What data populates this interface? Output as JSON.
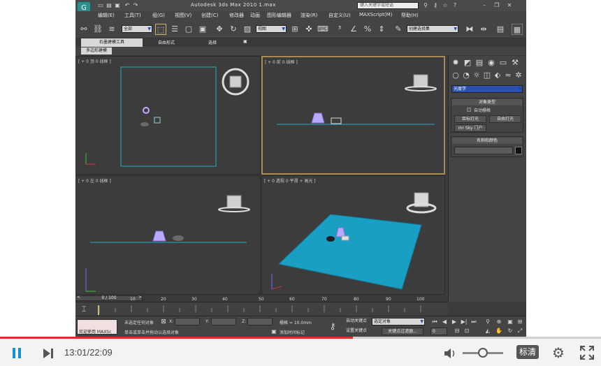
{
  "app": {
    "title": "Autodesk 3ds Max  2010    1.max",
    "search_placeholder": "键入关键字或短语",
    "menus": [
      "编辑(E)",
      "工具(T)",
      "组(G)",
      "视图(V)",
      "创建(C)",
      "修改器",
      "动画",
      "图形编辑器",
      "渲染(R)",
      "自定义(U)",
      "MAXScript(M)",
      "帮助(H)"
    ],
    "toolbar": {
      "selection_filter": "全部",
      "reference_coord": "视图",
      "named_selection": "创建选择集"
    },
    "ribbon_tabs": [
      "石墨建模工具",
      "自由形式",
      "选择",
      "▣"
    ],
    "subribbon_label": "多边形建模"
  },
  "viewports": {
    "top": {
      "label": "[ + 0 顶 0 线框 ]"
    },
    "front": {
      "label": "[ + 0 前 0 线框 ]"
    },
    "left": {
      "label": "[ + 0 左 0 线框 ]"
    },
    "perspective": {
      "label": "[ + 0 透视 0 平滑 + 高光 ]"
    }
  },
  "command_panel": {
    "category": "光度学",
    "rollout_object_type": "对象类型",
    "auto_grid": "自动栅格",
    "buttons": [
      "目标灯光",
      "自由灯光",
      "mr Sky 门户"
    ],
    "rollout_name_color": "名称和颜色",
    "color_swatch": "#111111"
  },
  "timeline": {
    "range": "0 / 100",
    "ticks": [
      "0",
      "10",
      "20",
      "30",
      "40",
      "50",
      "60",
      "70",
      "80",
      "90",
      "100"
    ]
  },
  "status": {
    "welcome": "欢迎使用 MAXSc",
    "selected": "未选定任何对象",
    "prompt": "单击或单击并拖动以选择对象",
    "x_label": "X:",
    "y_label": "Y:",
    "z_label": "Z:",
    "grid": "栅格 = 10.0mm",
    "add_time_tag": "添加时间标记",
    "auto_key": "自动关键点",
    "set_key": "设置关键点",
    "selected_dropdown": "选定对象",
    "key_filters": "关键点过滤器...",
    "frame": "0"
  },
  "player": {
    "time": "13:01/22:09",
    "quality": "标清",
    "progress_fraction": 0.587,
    "volume_fraction": 0.5
  }
}
